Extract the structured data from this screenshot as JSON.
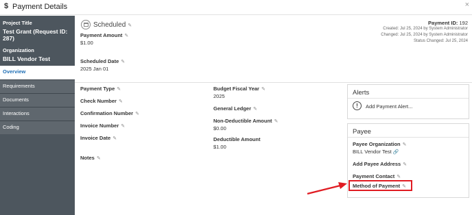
{
  "window": {
    "title": "Payment Details",
    "title_icon": "dollar-icon",
    "close_label": "×"
  },
  "sidebar": {
    "project_title_label": "Project Title",
    "project_title_value": "Test Grant (Request ID: 287)",
    "organization_label": "Organization",
    "organization_value": "BILL Vendor Test",
    "nav": [
      {
        "label": "Overview",
        "active": true
      },
      {
        "label": "Requirements"
      },
      {
        "label": "Documents"
      },
      {
        "label": "Interactions"
      },
      {
        "label": "Coding"
      }
    ]
  },
  "header": {
    "status": "Scheduled",
    "payment_amount_label": "Payment Amount",
    "payment_amount_value": "$1.00",
    "payment_id_label": "Payment ID:",
    "payment_id_value": "192",
    "created": "Created: Jul 25, 2024 by System Administrator",
    "changed": "Changed: Jul 25, 2024 by System Administrator",
    "status_changed": "Status Changed: Jul 25, 2024",
    "scheduled_date_label": "Scheduled Date",
    "scheduled_date_value": "2025 Jan 01"
  },
  "fields_left": {
    "payment_type": "Payment Type",
    "check_number": "Check Number",
    "confirmation_number": "Confirmation Number",
    "invoice_number": "Invoice Number",
    "invoice_date": "Invoice Date",
    "notes": "Notes"
  },
  "fields_mid": {
    "budget_fiscal_year_label": "Budget Fiscal Year",
    "budget_fiscal_year_value": "2025",
    "general_ledger_label": "General Ledger",
    "non_deductible_label": "Non-Deductible Amount",
    "non_deductible_value": "$0.00",
    "deductible_label": "Deductible Amount",
    "deductible_value": "$1.00"
  },
  "alerts": {
    "title": "Alerts",
    "add_label": "Add Payment Alert..."
  },
  "payee": {
    "title": "Payee",
    "organization_label": "Payee Organization",
    "organization_value": "BILL Vendor Test",
    "add_address_label": "Add Payee Address",
    "payment_contact_label": "Payment Contact",
    "method_of_payment_label": "Method of Payment"
  },
  "annotation": {
    "highlight_color": "#e01b22"
  },
  "colors": {
    "sidebar_bg": "#4d565e",
    "active_nav_text": "#1f6fb5"
  }
}
